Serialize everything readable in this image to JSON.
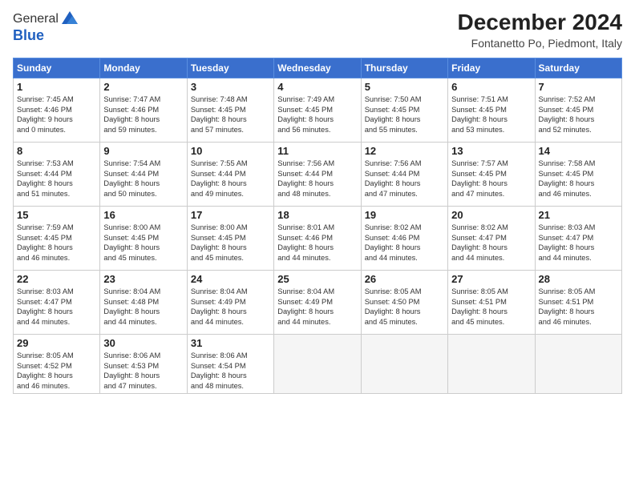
{
  "header": {
    "logo_line1": "General",
    "logo_line2": "Blue",
    "month_year": "December 2024",
    "location": "Fontanetto Po, Piedmont, Italy"
  },
  "days_of_week": [
    "Sunday",
    "Monday",
    "Tuesday",
    "Wednesday",
    "Thursday",
    "Friday",
    "Saturday"
  ],
  "weeks": [
    [
      {
        "day": 1,
        "lines": [
          "Sunrise: 7:45 AM",
          "Sunset: 4:46 PM",
          "Daylight: 9 hours",
          "and 0 minutes."
        ]
      },
      {
        "day": 2,
        "lines": [
          "Sunrise: 7:47 AM",
          "Sunset: 4:46 PM",
          "Daylight: 8 hours",
          "and 59 minutes."
        ]
      },
      {
        "day": 3,
        "lines": [
          "Sunrise: 7:48 AM",
          "Sunset: 4:45 PM",
          "Daylight: 8 hours",
          "and 57 minutes."
        ]
      },
      {
        "day": 4,
        "lines": [
          "Sunrise: 7:49 AM",
          "Sunset: 4:45 PM",
          "Daylight: 8 hours",
          "and 56 minutes."
        ]
      },
      {
        "day": 5,
        "lines": [
          "Sunrise: 7:50 AM",
          "Sunset: 4:45 PM",
          "Daylight: 8 hours",
          "and 55 minutes."
        ]
      },
      {
        "day": 6,
        "lines": [
          "Sunrise: 7:51 AM",
          "Sunset: 4:45 PM",
          "Daylight: 8 hours",
          "and 53 minutes."
        ]
      },
      {
        "day": 7,
        "lines": [
          "Sunrise: 7:52 AM",
          "Sunset: 4:45 PM",
          "Daylight: 8 hours",
          "and 52 minutes."
        ]
      }
    ],
    [
      {
        "day": 8,
        "lines": [
          "Sunrise: 7:53 AM",
          "Sunset: 4:44 PM",
          "Daylight: 8 hours",
          "and 51 minutes."
        ]
      },
      {
        "day": 9,
        "lines": [
          "Sunrise: 7:54 AM",
          "Sunset: 4:44 PM",
          "Daylight: 8 hours",
          "and 50 minutes."
        ]
      },
      {
        "day": 10,
        "lines": [
          "Sunrise: 7:55 AM",
          "Sunset: 4:44 PM",
          "Daylight: 8 hours",
          "and 49 minutes."
        ]
      },
      {
        "day": 11,
        "lines": [
          "Sunrise: 7:56 AM",
          "Sunset: 4:44 PM",
          "Daylight: 8 hours",
          "and 48 minutes."
        ]
      },
      {
        "day": 12,
        "lines": [
          "Sunrise: 7:56 AM",
          "Sunset: 4:44 PM",
          "Daylight: 8 hours",
          "and 47 minutes."
        ]
      },
      {
        "day": 13,
        "lines": [
          "Sunrise: 7:57 AM",
          "Sunset: 4:45 PM",
          "Daylight: 8 hours",
          "and 47 minutes."
        ]
      },
      {
        "day": 14,
        "lines": [
          "Sunrise: 7:58 AM",
          "Sunset: 4:45 PM",
          "Daylight: 8 hours",
          "and 46 minutes."
        ]
      }
    ],
    [
      {
        "day": 15,
        "lines": [
          "Sunrise: 7:59 AM",
          "Sunset: 4:45 PM",
          "Daylight: 8 hours",
          "and 46 minutes."
        ]
      },
      {
        "day": 16,
        "lines": [
          "Sunrise: 8:00 AM",
          "Sunset: 4:45 PM",
          "Daylight: 8 hours",
          "and 45 minutes."
        ]
      },
      {
        "day": 17,
        "lines": [
          "Sunrise: 8:00 AM",
          "Sunset: 4:45 PM",
          "Daylight: 8 hours",
          "and 45 minutes."
        ]
      },
      {
        "day": 18,
        "lines": [
          "Sunrise: 8:01 AM",
          "Sunset: 4:46 PM",
          "Daylight: 8 hours",
          "and 44 minutes."
        ]
      },
      {
        "day": 19,
        "lines": [
          "Sunrise: 8:02 AM",
          "Sunset: 4:46 PM",
          "Daylight: 8 hours",
          "and 44 minutes."
        ]
      },
      {
        "day": 20,
        "lines": [
          "Sunrise: 8:02 AM",
          "Sunset: 4:47 PM",
          "Daylight: 8 hours",
          "and 44 minutes."
        ]
      },
      {
        "day": 21,
        "lines": [
          "Sunrise: 8:03 AM",
          "Sunset: 4:47 PM",
          "Daylight: 8 hours",
          "and 44 minutes."
        ]
      }
    ],
    [
      {
        "day": 22,
        "lines": [
          "Sunrise: 8:03 AM",
          "Sunset: 4:47 PM",
          "Daylight: 8 hours",
          "and 44 minutes."
        ]
      },
      {
        "day": 23,
        "lines": [
          "Sunrise: 8:04 AM",
          "Sunset: 4:48 PM",
          "Daylight: 8 hours",
          "and 44 minutes."
        ]
      },
      {
        "day": 24,
        "lines": [
          "Sunrise: 8:04 AM",
          "Sunset: 4:49 PM",
          "Daylight: 8 hours",
          "and 44 minutes."
        ]
      },
      {
        "day": 25,
        "lines": [
          "Sunrise: 8:04 AM",
          "Sunset: 4:49 PM",
          "Daylight: 8 hours",
          "and 44 minutes."
        ]
      },
      {
        "day": 26,
        "lines": [
          "Sunrise: 8:05 AM",
          "Sunset: 4:50 PM",
          "Daylight: 8 hours",
          "and 45 minutes."
        ]
      },
      {
        "day": 27,
        "lines": [
          "Sunrise: 8:05 AM",
          "Sunset: 4:51 PM",
          "Daylight: 8 hours",
          "and 45 minutes."
        ]
      },
      {
        "day": 28,
        "lines": [
          "Sunrise: 8:05 AM",
          "Sunset: 4:51 PM",
          "Daylight: 8 hours",
          "and 46 minutes."
        ]
      }
    ],
    [
      {
        "day": 29,
        "lines": [
          "Sunrise: 8:05 AM",
          "Sunset: 4:52 PM",
          "Daylight: 8 hours",
          "and 46 minutes."
        ]
      },
      {
        "day": 30,
        "lines": [
          "Sunrise: 8:06 AM",
          "Sunset: 4:53 PM",
          "Daylight: 8 hours",
          "and 47 minutes."
        ]
      },
      {
        "day": 31,
        "lines": [
          "Sunrise: 8:06 AM",
          "Sunset: 4:54 PM",
          "Daylight: 8 hours",
          "and 48 minutes."
        ]
      },
      null,
      null,
      null,
      null
    ]
  ]
}
